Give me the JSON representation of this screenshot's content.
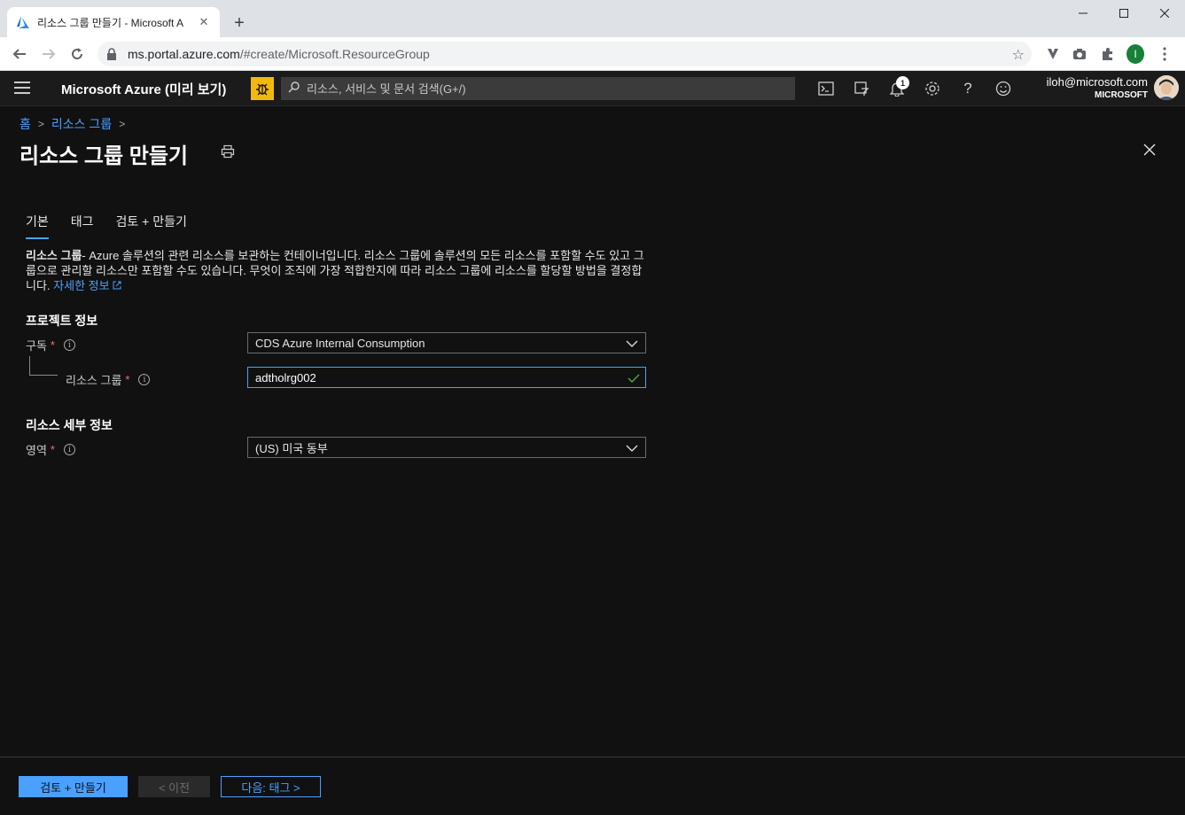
{
  "browser": {
    "tab_title": "리소스 그룹 만들기 - Microsoft A",
    "url_host": "ms.portal.azure.com",
    "url_path": "/#create/Microsoft.ResourceGroup",
    "profile_initial": "I"
  },
  "header": {
    "brand": "Microsoft Azure (미리 보기)",
    "search_placeholder": "리소스, 서비스 및 문서 검색(G+/)",
    "notification_count": "1",
    "account_email": "iloh@microsoft.com",
    "account_org": "MICROSOFT"
  },
  "breadcrumb": {
    "items": [
      "홈",
      "리소스 그룹"
    ]
  },
  "page": {
    "title": "리소스 그룹 만들기"
  },
  "tabs": [
    "기본",
    "태그",
    "검토 + 만들기"
  ],
  "description": {
    "bold": "리소스 그룹",
    "text": "- Azure 솔루션의 관련 리소스를 보관하는 컨테이너입니다. 리소스 그룹에 솔루션의 모든 리소스를 포함할 수도 있고 그룹으로 관리할 리소스만 포함할 수도 있습니다. 무엇이 조직에 가장 적합한지에 따라 리소스 그룹에 리소스를 할당할 방법을 결정합니다. ",
    "link": "자세한 정보"
  },
  "project": {
    "section_title": "프로젝트 정보",
    "subscription_label": "구독",
    "subscription_value": "CDS Azure Internal Consumption",
    "resource_group_label": "리소스 그룹",
    "resource_group_value": "adtholrg002"
  },
  "details": {
    "section_title": "리소스 세부 정보",
    "region_label": "영역",
    "region_value": "(US) 미국 동부"
  },
  "footer": {
    "review_create": "검토 + 만들기",
    "previous": "< 이전",
    "next": "다음: 태그 >"
  }
}
